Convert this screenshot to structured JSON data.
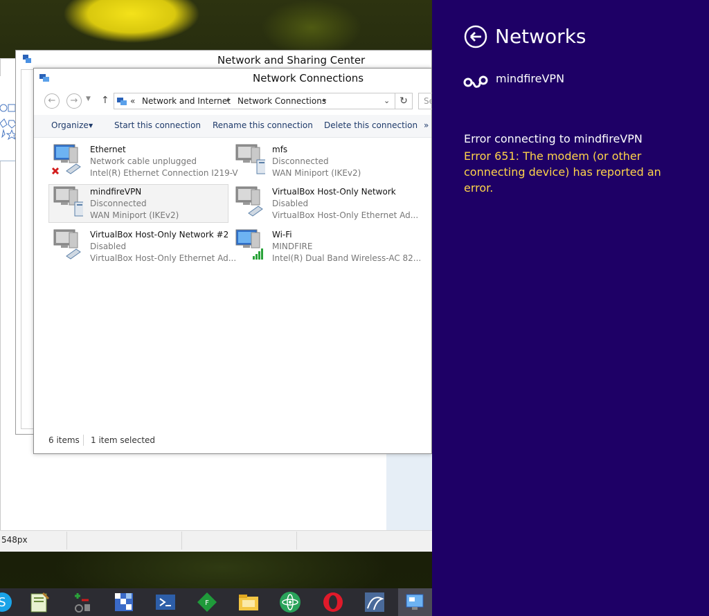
{
  "background_app": {
    "status_text": "548px"
  },
  "sharing_center": {
    "title": "Network and Sharing Center"
  },
  "connections_window": {
    "title": "Network Connections",
    "address": {
      "prefix": "«",
      "crumbs": [
        "Network and Internet",
        "Network Connections"
      ],
      "separator": "▸"
    },
    "search_placeholder": "Se",
    "toolbar": {
      "organize": "Organize",
      "start": "Start this connection",
      "rename": "Rename this connection",
      "delete": "Delete this connection",
      "more": "»"
    },
    "items": [
      {
        "name": "Ethernet",
        "status": "Network cable unplugged",
        "device": "Intel(R) Ethernet Connection I219-V",
        "icon": "ethernet-disconnected-icon"
      },
      {
        "name": "mfs",
        "status": "Disconnected",
        "device": "WAN Miniport (IKEv2)",
        "icon": "vpn-connection-icon"
      },
      {
        "name": "mindfireVPN",
        "status": "Disconnected",
        "device": "WAN Miniport (IKEv2)",
        "icon": "vpn-connection-icon"
      },
      {
        "name": "VirtualBox Host-Only Network",
        "status": "Disabled",
        "device": "VirtualBox Host-Only Ethernet Ad...",
        "icon": "ethernet-disabled-icon"
      },
      {
        "name": "VirtualBox Host-Only Network #2",
        "status": "Disabled",
        "device": "VirtualBox Host-Only Ethernet Ad...",
        "icon": "ethernet-disabled-icon"
      },
      {
        "name": "Wi-Fi",
        "status": "MINDFIRE",
        "device": "Intel(R) Dual Band Wireless-AC 82...",
        "icon": "wifi-signal-icon"
      }
    ],
    "status_bar": {
      "count": "6 items",
      "selected": "1 item selected"
    }
  },
  "charm": {
    "title": "Networks",
    "vpn_name": "mindfireVPN",
    "error_heading": "Error connecting to mindfireVPN",
    "error_message": "Error 651: The modem (or other connecting device) has reported an error."
  },
  "taskbar_icons": [
    "skype-icon",
    "notepad-plus-icon",
    "git-icon",
    "table-app-icon",
    "powershell-icon",
    "ftp-app-icon",
    "file-explorer-icon",
    "atom-editor-icon",
    "opera-icon",
    "mysql-workbench-icon",
    "control-panel-icon"
  ],
  "colors": {
    "charm_bg": "#1e0066",
    "error_text": "#ffd44a",
    "toolbar_text": "#1e3a6a"
  }
}
